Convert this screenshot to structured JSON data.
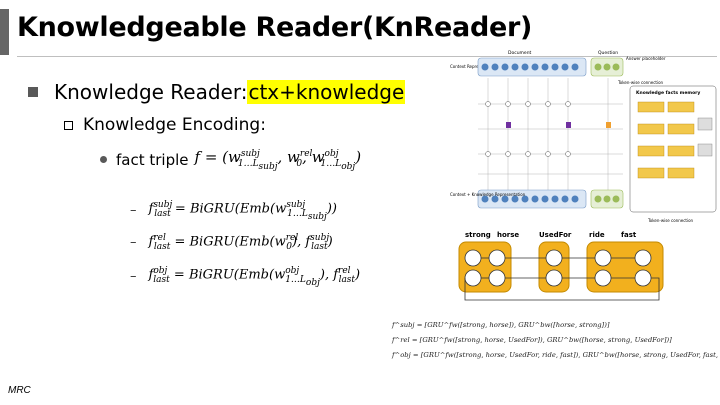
{
  "title": "Knowledgeable Reader(KnReader)",
  "bullet1": {
    "prefix": "Knowledge Reader: ",
    "highlight": "ctx+knowledge"
  },
  "bullet2": "Knowledge Encoding:",
  "bullet3_prefix": "fact triple",
  "equations": [
    "BiGRU",
    "BiGRU",
    "BiGRU"
  ],
  "footer": "MRC",
  "diagram": {
    "document_label": "Document",
    "question_label": "Question",
    "answer_placeholder": "Answer placeholder",
    "context_repr": "Context Representation",
    "knowledge_repr": "Context + Knowledge Representation",
    "token_wise": "Token-wise connection",
    "kfm_title": "Knowledge facts memory"
  },
  "chain": {
    "words": [
      "strong",
      "horse",
      "UsedFor",
      "ride",
      "fast"
    ]
  },
  "formulas": [
    "f^subj = [GRU^fw([strong, horse]), GRU^bw([horse, strong])]",
    "f^rel = [GRU^fw([strong, horse, UsedFor]), GRU^bw([horse, strong, UsedFor])]",
    "f^obj = [GRU^fw([strong, horse, UsedFor, ride, fast]), GRU^bw([horse, strong, UsedFor, fast, ride])]"
  ],
  "colors": {
    "highlight": "#ffff00",
    "chain_fill": "#f2b01e",
    "node_blue": "#4f81bd",
    "node_green": "#9bbb59",
    "node_purple": "#7030a0",
    "node_orange": "#f0a030"
  }
}
